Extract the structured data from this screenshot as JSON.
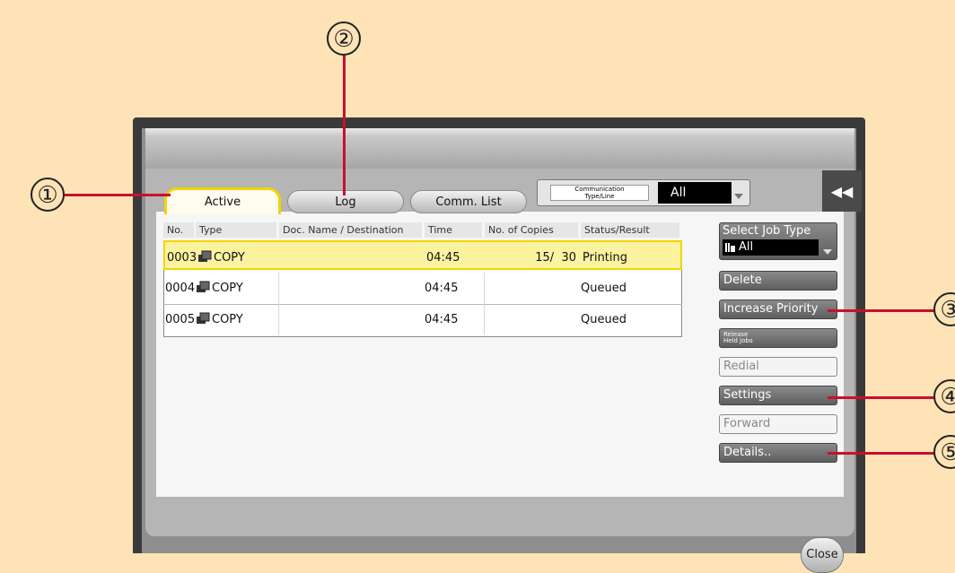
{
  "tabs": {
    "active": "Active",
    "log": "Log",
    "comm_list": "Comm. List"
  },
  "comm_type": {
    "label_line1": "Communication",
    "label_line2": "Type/Line",
    "value": "All"
  },
  "table": {
    "columns": [
      "No.",
      "Type",
      "Doc. Name / Destination",
      "Time",
      "No. of Copies",
      "Status/Result"
    ],
    "rows": [
      {
        "no": "0003",
        "type": "COPY",
        "doc": "",
        "time": "04:45",
        "copies": "15/  30",
        "status": "Printing"
      },
      {
        "no": "0004",
        "type": "COPY",
        "doc": "",
        "time": "04:45",
        "copies": "",
        "status": "Queued"
      },
      {
        "no": "0005",
        "type": "COPY",
        "doc": "",
        "time": "04:45",
        "copies": "",
        "status": "Queued"
      }
    ]
  },
  "side": {
    "select_job_type": "Select Job Type",
    "job_type_value": "All",
    "delete": "Delete",
    "increase_priority": "Increase Priority",
    "release_line1": "Release",
    "release_line2": "Held Jobs",
    "redial": "Redial",
    "settings": "Settings",
    "forward": "Forward",
    "details": "Details.."
  },
  "close": "Close",
  "callouts": [
    "①",
    "②",
    "③",
    "④",
    "⑤"
  ],
  "colors": {
    "highlight": "#f3d400",
    "row_highlight": "#fbf3a0",
    "callout_line": "#c8102e",
    "background": "#fde3b6"
  }
}
